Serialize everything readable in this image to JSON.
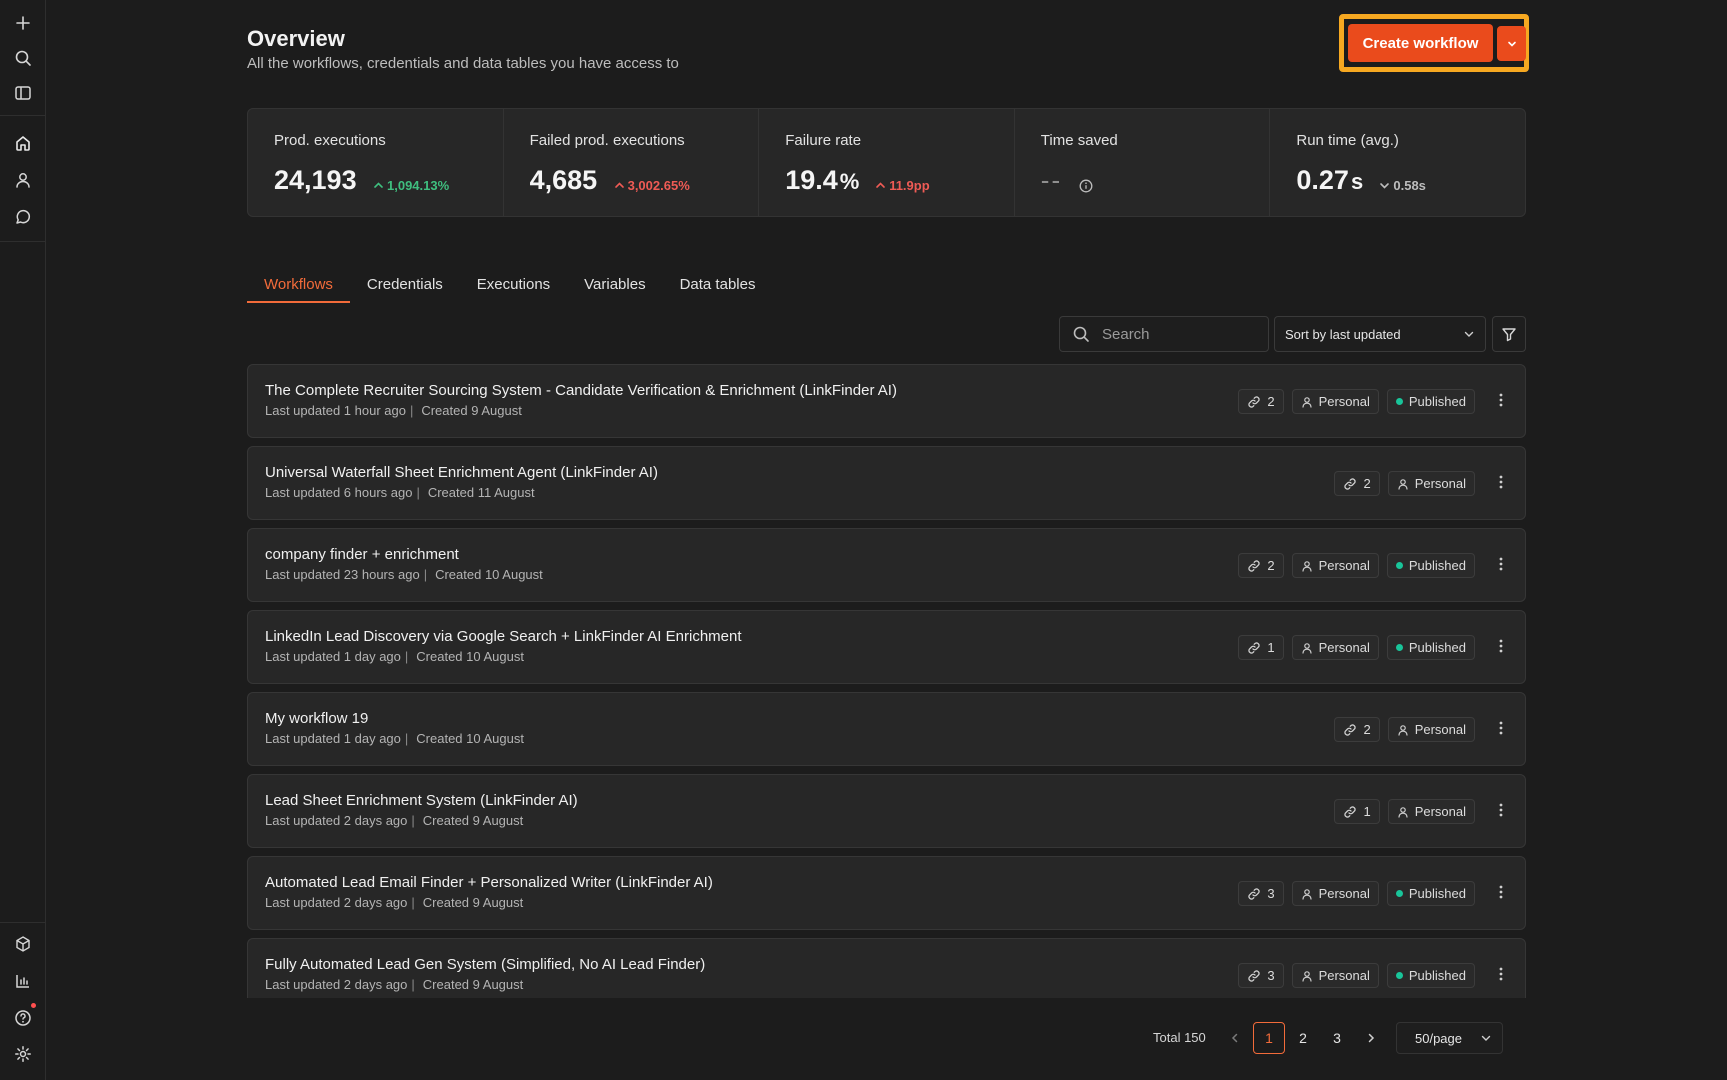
{
  "sidebar": {
    "top_icons": [
      "plus-icon",
      "search-icon",
      "sidebar-toggle-icon"
    ],
    "nav_icons": [
      "home-icon",
      "user-icon",
      "chat-icon"
    ],
    "bottom_icons": [
      "templates-icon",
      "insights-icon",
      "help-icon",
      "settings-icon"
    ]
  },
  "header": {
    "title": "Overview",
    "subtitle": "All the workflows, credentials and data tables you have access to",
    "create_label": "Create workflow"
  },
  "colors": {
    "accent": "#ea4b1c",
    "highlight": "#f6a821",
    "published": "#19c59a",
    "positive": "#3fbf7f",
    "negative": "#ef5b55"
  },
  "stats": [
    {
      "label": "Prod. executions",
      "value": "24,193",
      "unit": "",
      "delta": "1,094.13%",
      "delta_dir": "up",
      "tone": "green"
    },
    {
      "label": "Failed prod. executions",
      "value": "4,685",
      "unit": "",
      "delta": "3,002.65%",
      "delta_dir": "up",
      "tone": "red"
    },
    {
      "label": "Failure rate",
      "value": "19.4",
      "unit": "%",
      "delta": "11.9pp",
      "delta_dir": "up",
      "tone": "red"
    },
    {
      "label": "Time saved",
      "value": "--",
      "unit": "",
      "delta": "",
      "delta_dir": "",
      "tone": "gray"
    },
    {
      "label": "Run time (avg.)",
      "value": "0.27",
      "unit": "s",
      "delta": "0.58s",
      "delta_dir": "down",
      "tone": "gray"
    }
  ],
  "tabs": [
    {
      "label": "Workflows",
      "active": true
    },
    {
      "label": "Credentials",
      "active": false
    },
    {
      "label": "Executions",
      "active": false
    },
    {
      "label": "Variables",
      "active": false
    },
    {
      "label": "Data tables",
      "active": false
    }
  ],
  "toolbar": {
    "search_placeholder": "Search",
    "sort_label": "Sort by last updated"
  },
  "workflows": [
    {
      "title": "The Complete Recruiter Sourcing System - Candidate Verification & Enrichment (LinkFinder AI)",
      "updated": "Last updated 1 hour ago",
      "created": "Created 9 August",
      "links": "2",
      "owner": "Personal",
      "status": "Published"
    },
    {
      "title": "Universal Waterfall Sheet Enrichment Agent (LinkFinder AI)",
      "updated": "Last updated 6 hours ago",
      "created": "Created 11 August",
      "links": "2",
      "owner": "Personal",
      "status": ""
    },
    {
      "title": "company finder + enrichment",
      "updated": "Last updated 23 hours ago",
      "created": "Created 10 August",
      "links": "2",
      "owner": "Personal",
      "status": "Published"
    },
    {
      "title": "LinkedIn Lead Discovery via Google Search + LinkFinder AI Enrichment",
      "updated": "Last updated 1 day ago",
      "created": "Created 10 August",
      "links": "1",
      "owner": "Personal",
      "status": "Published"
    },
    {
      "title": "My workflow 19",
      "updated": "Last updated 1 day ago",
      "created": "Created 10 August",
      "links": "2",
      "owner": "Personal",
      "status": ""
    },
    {
      "title": "Lead Sheet Enrichment System (LinkFinder AI)",
      "updated": "Last updated 2 days ago",
      "created": "Created 9 August",
      "links": "1",
      "owner": "Personal",
      "status": ""
    },
    {
      "title": "Automated Lead Email Finder + Personalized Writer (LinkFinder AI)",
      "updated": "Last updated 2 days ago",
      "created": "Created 9 August",
      "links": "3",
      "owner": "Personal",
      "status": "Published"
    },
    {
      "title": "Fully Automated Lead Gen System (Simplified, No AI Lead Finder)",
      "updated": "Last updated 2 days ago",
      "created": "Created 9 August",
      "links": "3",
      "owner": "Personal",
      "status": "Published"
    }
  ],
  "pagination": {
    "total_label": "Total 150",
    "pages": [
      "1",
      "2",
      "3"
    ],
    "current": "1",
    "per_page": "50/page"
  }
}
